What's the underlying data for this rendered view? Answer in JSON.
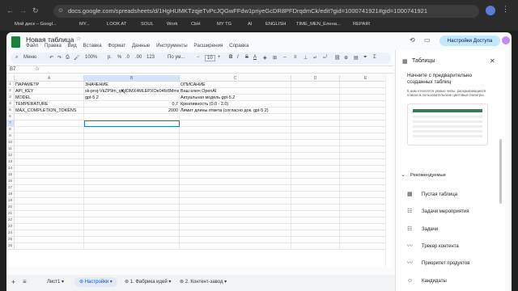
{
  "browser": {
    "url": "docs.google.com/spreadsheets/d/1HgHUMKTzqjeTvPcJQGwFFdw1priyeGcDR8PFDrqdmCk/edit?gid=1000741921#gid=1000741921",
    "bookmarks": [
      "Мой диск – Googl...",
      "MY...",
      "LOOK AT",
      "SOUL",
      "Work",
      "CbH",
      "MY TG",
      "AI",
      "ENGLISH",
      "TIME_MEN_Елена...",
      "REPAIR"
    ]
  },
  "doc": {
    "title": "Новая таблица",
    "menus": [
      "Файл",
      "Правка",
      "Вид",
      "Вставка",
      "Формат",
      "Данные",
      "Инструменты",
      "Расширения",
      "Справка"
    ],
    "share_label": "Настройки Доступа"
  },
  "toolbar": {
    "menu_label": "Меню",
    "zoom": "100%",
    "currency": "р.",
    "percent": "%",
    "dec1": ".0",
    "dec2": ".00",
    "numfmt": "123",
    "font": "По ум...",
    "font_size": "10"
  },
  "formula": {
    "cell_ref": "B7",
    "fx": "fx",
    "value": ""
  },
  "grid": {
    "columns": [
      "A",
      "B",
      "C",
      "D",
      "E"
    ],
    "rows": [
      "1",
      "2",
      "3",
      "4",
      "5",
      "6",
      "7",
      "8",
      "9",
      "10",
      "11",
      "12",
      "13",
      "14",
      "15",
      "16",
      "17",
      "18",
      "19",
      "20",
      "21",
      "22",
      "23",
      "24",
      "25",
      "26"
    ],
    "cells": [
      [
        "ПАРАМЕТР",
        "ЗНАЧЕНИЕ",
        "ОПИСАНИЕ"
      ],
      [
        "API_KEY",
        "sk-proj-VkZP9m_qYdDMX4MLEPXOe04fz8MmsP...",
        "Ваш ключ OpenAI"
      ],
      [
        "MODEL",
        "gpt-5.2",
        "Актуальная модель gpt-5.2"
      ],
      [
        "TEMPERATURE",
        "0,7",
        "Креативность (0.0 - 2.0)"
      ],
      [
        "MAX_COMPLETION_TOKENS",
        "2000",
        "Лимит длины ответа (согласно док. gpt-5.2)"
      ]
    ]
  },
  "sheets": {
    "tabs": [
      "Лист1",
      "Настройки",
      "1. Фабрика идей",
      "2. Контент-завод"
    ],
    "active": "Настройки"
  },
  "panel": {
    "title": "Таблицы",
    "heading": "Начните с предварительно созданных таблиц",
    "desc": "К ним относятся умные чипы, раскрывающиеся списки и пользовательские цветовые палитры.",
    "recommended": "Рекомендуемые",
    "templates": [
      "Пустая таблица",
      "Задачи мероприятия",
      "Задачи",
      "Трекер контента",
      "Приоритет продуктов",
      "Кандидаты"
    ]
  }
}
